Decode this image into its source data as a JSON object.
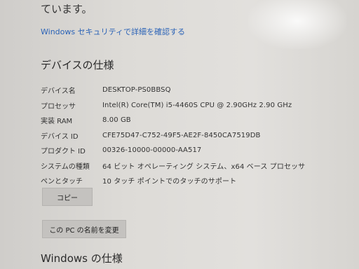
{
  "header": {
    "top_text": "ています。",
    "security_link": "Windows セキュリティで詳細を確認する"
  },
  "device_specs": {
    "title": "デバイスの仕様",
    "rows": [
      {
        "label": "デバイス名",
        "value": "DESKTOP-PS0BBSQ"
      },
      {
        "label": "プロセッサ",
        "value": "Intel(R) Core(TM) i5-4460S CPU @ 2.90GHz   2.90 GHz"
      },
      {
        "label": "実装 RAM",
        "value": "8.00 GB"
      },
      {
        "label": "デバイス ID",
        "value": "CFE75D47-C752-49F5-AE2F-8450CA7519DB"
      },
      {
        "label": "プロダクト ID",
        "value": "00326-10000-00000-AA517"
      },
      {
        "label": "システムの種類",
        "value": "64 ビット オペレーティング システム、x64 ベース プロセッサ"
      },
      {
        "label": "ペンとタッチ",
        "value": "10 タッチ ポイントでのタッチのサポート"
      }
    ],
    "copy_button": "コピー",
    "rename_button": "この PC の名前を変更"
  },
  "windows_specs": {
    "title": "Windows の仕様"
  }
}
